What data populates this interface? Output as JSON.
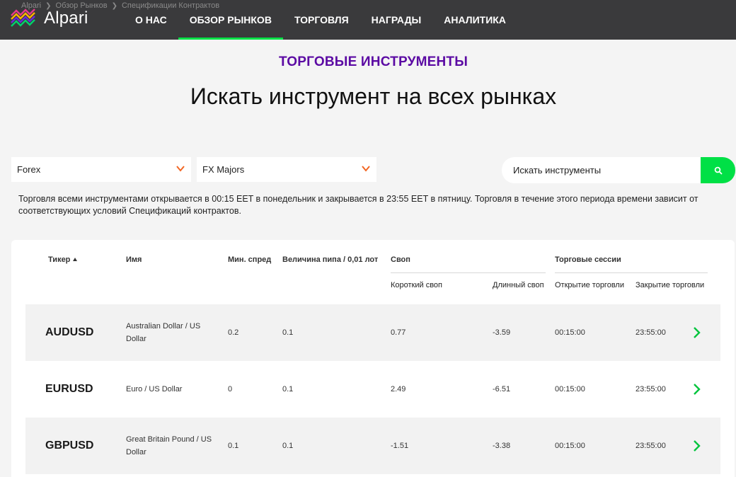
{
  "breadcrumb": [
    "Alpari",
    "Обзор Рынков",
    "Спецификации Контрактов"
  ],
  "logo": {
    "text": "Alpari",
    "colors": [
      "#e63a8c",
      "#ffb300",
      "#6c2bd9",
      "#00d26a"
    ]
  },
  "nav": {
    "items": [
      "О НАС",
      "ОБЗОР РЫНКОВ",
      "ТОРГОВЛЯ",
      "НАГРАДЫ",
      "АНАЛИТИКА"
    ],
    "active": "ОБЗОР РЫНКОВ"
  },
  "section_label": "ТОРГОВЫЕ ИНСТРУМЕНТЫ",
  "page_title": "Искать инструмент на всех рынках",
  "filters": {
    "market": "Forex",
    "group": "FX Majors",
    "search_placeholder": "Искать инструменты"
  },
  "info_text": "Торговля всеми инструментами открывается в 00:15 EET в понедельник и закрывается в 23:55 EET в пятницу. Торговля в течение этого периода времени зависит от соответствующих условий Спецификаций контрактов.",
  "table": {
    "headers": {
      "ticker": "Тикер",
      "name": "Имя",
      "min_spread": "Мин. спред",
      "pip_value": "Величина пипа / 0,01 лот",
      "swap": "Своп",
      "short_swap": "Короткий своп",
      "long_swap": "Длинный своп",
      "sessions": "Торговые сессии",
      "open": "Открытие торговли",
      "close": "Закрытие торговли"
    },
    "rows": [
      {
        "ticker": "AUDUSD",
        "name": "Australian Dollar / US Dollar",
        "min_spread": "0.2",
        "pip_value": "0.1",
        "short_swap": "0.77",
        "long_swap": "-3.59",
        "open": "00:15:00",
        "close": "23:55:00"
      },
      {
        "ticker": "EURUSD",
        "name": "Euro / US Dollar",
        "min_spread": "0",
        "pip_value": "0.1",
        "short_swap": "2.49",
        "long_swap": "-6.51",
        "open": "00:15:00",
        "close": "23:55:00"
      },
      {
        "ticker": "GBPUSD",
        "name": "Great Britain Pound / US Dollar",
        "min_spread": "0.1",
        "pip_value": "0.1",
        "short_swap": "-1.51",
        "long_swap": "-3.38",
        "open": "00:15:00",
        "close": "23:55:00"
      }
    ]
  },
  "colors": {
    "header_bg": "#3a3a3c",
    "accent_green": "#00e046",
    "purple": "#5b0aa3",
    "chevron_orange": "#f26522"
  }
}
